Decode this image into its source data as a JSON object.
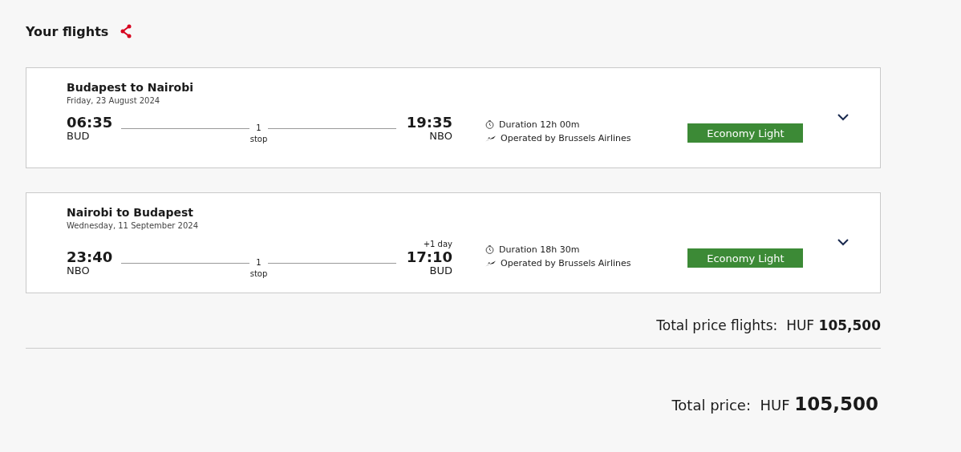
{
  "heading": "Your flights",
  "flights": [
    {
      "route": "Budapest to Nairobi",
      "date": "Friday, 23 August 2024",
      "depart_time": "06:35",
      "depart_code": "BUD",
      "stops_count": "1",
      "stops_label": "stop",
      "arrive_time": "19:35",
      "arrive_code": "NBO",
      "duration": "Duration 12h 00m",
      "operator": "Operated by Brussels Airlines",
      "fare": "Economy Light",
      "expanded": false
    },
    {
      "route": "Nairobi to Budapest",
      "date": "Wednesday, 11 September 2024",
      "depart_time": "23:40",
      "depart_code": "NBO",
      "stops_count": "1",
      "stops_label": "stop",
      "arrive_note": "+1 day",
      "arrive_time": "17:10",
      "arrive_code": "BUD",
      "duration": "Duration 18h 30m",
      "operator": "Operated by Brussels Airlines",
      "fare": "Economy Light",
      "expanded": false
    }
  ],
  "flights_total": {
    "label": "Total price flights:",
    "currency": "HUF",
    "amount": "105,500"
  },
  "total": {
    "label": "Total price:",
    "currency": "HUF",
    "amount": "105,500"
  }
}
